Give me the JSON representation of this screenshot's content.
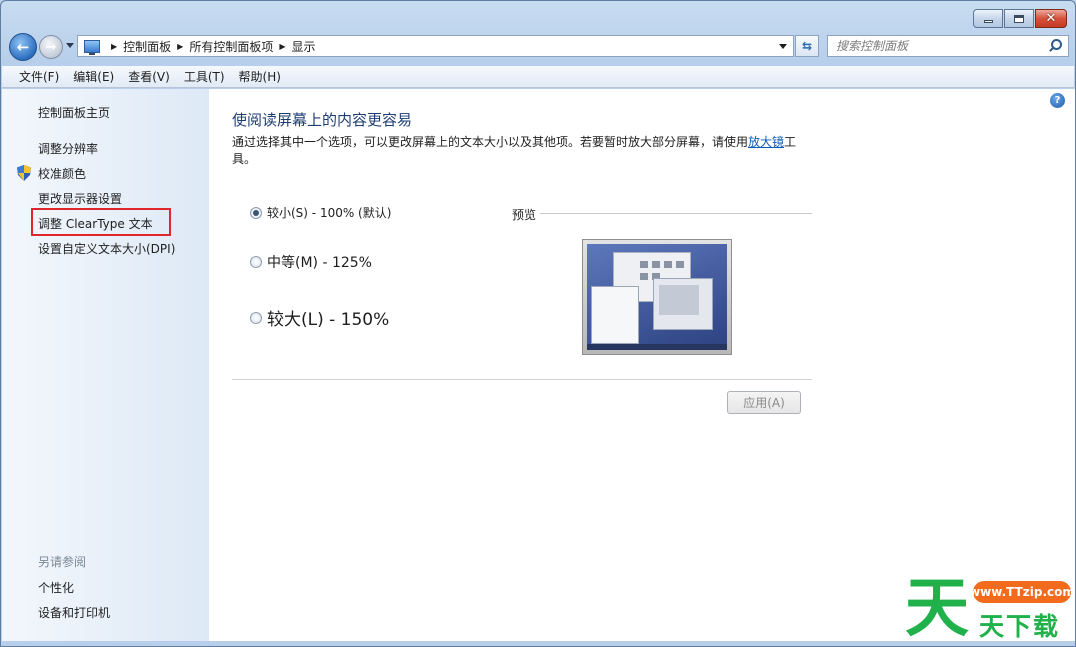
{
  "window": {
    "breadcrumbs": [
      "控制面板",
      "所有控制面板项",
      "显示"
    ],
    "search_placeholder": "搜索控制面板"
  },
  "menu": [
    "文件(F)",
    "编辑(E)",
    "查看(V)",
    "工具(T)",
    "帮助(H)"
  ],
  "sidebar": {
    "home": "控制面板主页",
    "items": [
      "调整分辨率",
      "校准颜色",
      "更改显示器设置",
      "调整 ClearType 文本",
      "设置自定义文本大小(DPI)"
    ],
    "see_also_title": "另请参阅",
    "see_also": [
      "个性化",
      "设备和打印机"
    ]
  },
  "main": {
    "title": "使阅读屏幕上的内容更容易",
    "desc_before": "通过选择其中一个选项，可以更改屏幕上的文本大小以及其他项。若要暂时放大部分屏幕，请使用",
    "desc_link": "放大镜",
    "desc_after": "工具。",
    "options": [
      {
        "label": "较小(S) - 100% (默认)",
        "checked": true
      },
      {
        "label": "中等(M) - 125%",
        "checked": false
      },
      {
        "label": "较大(L) - 150%",
        "checked": false
      }
    ],
    "preview_label": "预览",
    "apply_label": "应用(A)"
  },
  "watermark": {
    "char": "天",
    "url": "www.TTzip.com",
    "text": "天下载"
  },
  "colors": {
    "highlight_box": "#e0262b",
    "link": "#0b5cb8",
    "title": "#1e3e74",
    "watermark_green": "#20b14a",
    "watermark_orange": "#f26a1b"
  }
}
